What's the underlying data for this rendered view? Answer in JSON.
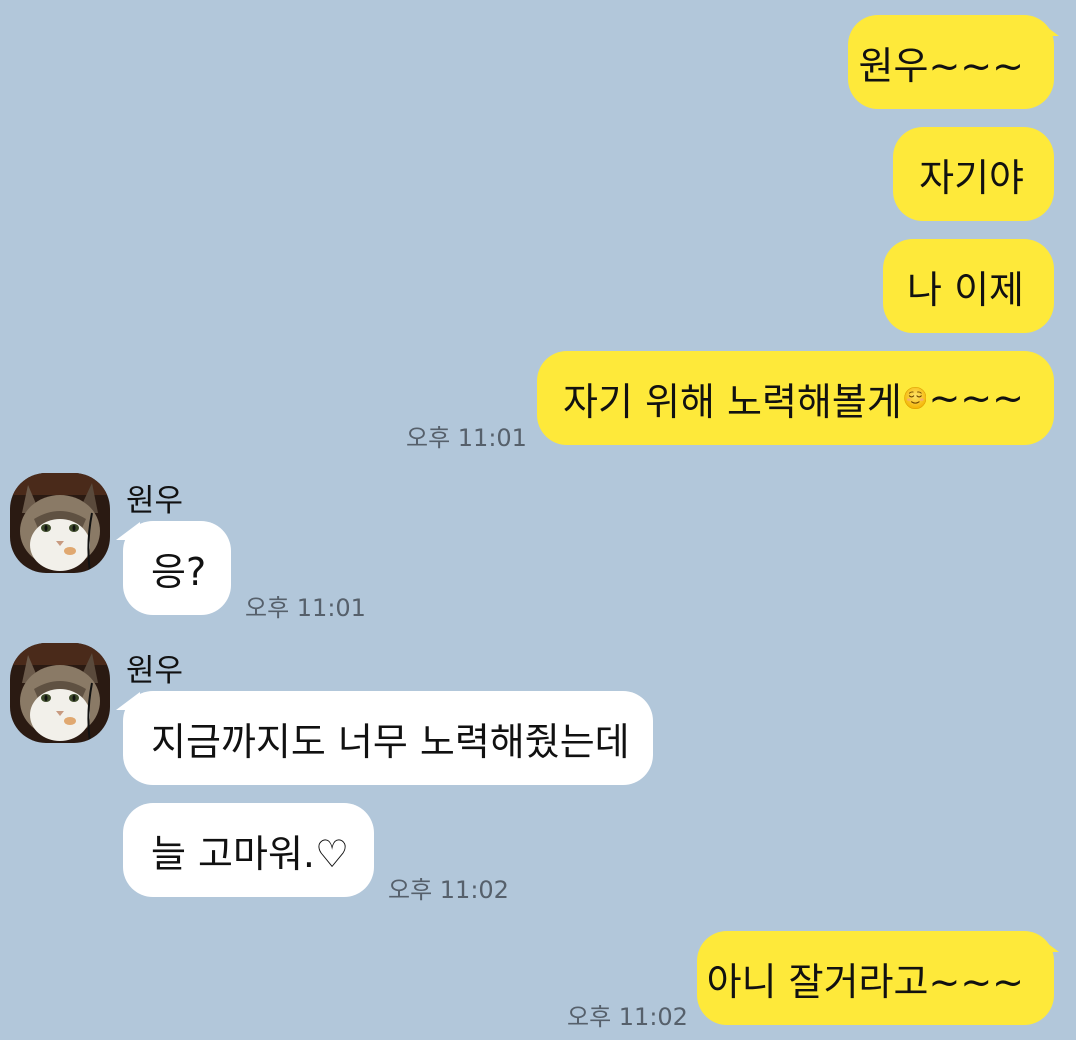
{
  "chat": {
    "contact_name": "원우",
    "messages": [
      {
        "from": "me",
        "text": "원우~~~"
      },
      {
        "from": "me",
        "text": "자기야"
      },
      {
        "from": "me",
        "text": "나 이제"
      },
      {
        "from": "me",
        "text_before_emoji": "자기 위해 노력해볼게",
        "emoji": "relieved-face-emoji",
        "text_after_emoji": "~~~",
        "time": "오후 11:01"
      },
      {
        "from": "them",
        "sender": "원우",
        "text": "응?",
        "time": "오후 11:01"
      },
      {
        "from": "them",
        "sender": "원우",
        "text": "지금까지도 너무 노력해줬는데"
      },
      {
        "from": "them",
        "text": "늘 고마워.♡",
        "time": "오후 11:02"
      },
      {
        "from": "me",
        "text": "아니 잘거라고~~~",
        "time": "오후 11:02"
      }
    ]
  },
  "colors": {
    "background": "#b2c7da",
    "my_bubble": "#fee93a",
    "their_bubble": "#ffffff",
    "time_text": "#56606b"
  }
}
